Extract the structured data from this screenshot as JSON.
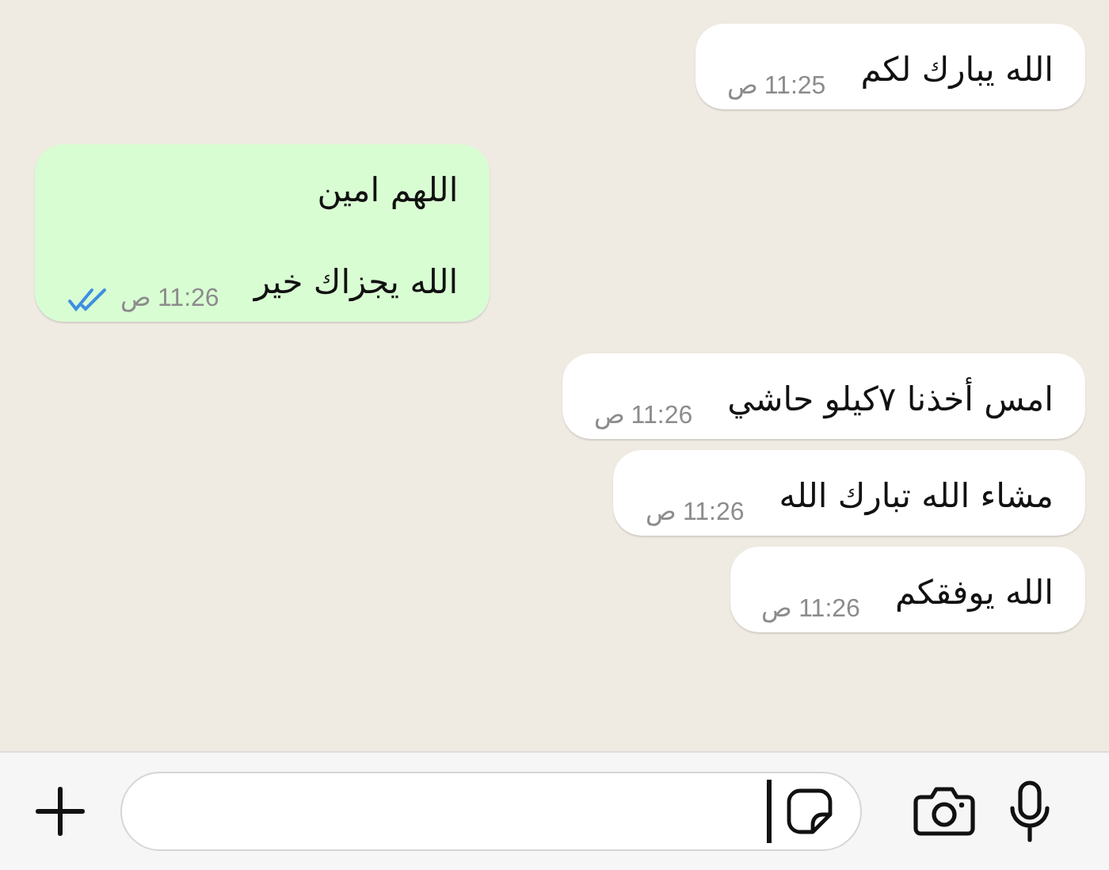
{
  "messages": [
    {
      "kind": "incoming",
      "lines": [
        "الله يبارك لكم"
      ],
      "time": "11:25 ص"
    },
    {
      "kind": "outgoing",
      "lines": [
        "اللهم امين",
        "الله يجزاك خير"
      ],
      "time": "11:26 ص",
      "read": true
    },
    {
      "kind": "incoming",
      "lines": [
        "امس أخذنا ٧كيلو حاشي"
      ],
      "time": "11:26 ص"
    },
    {
      "kind": "incoming",
      "lines": [
        "مشاء الله تبارك الله"
      ],
      "time": "11:26 ص"
    },
    {
      "kind": "incoming",
      "lines": [
        "الله يوفقكم"
      ],
      "time": "11:26 ص"
    }
  ],
  "composer": {
    "cursor": true
  }
}
